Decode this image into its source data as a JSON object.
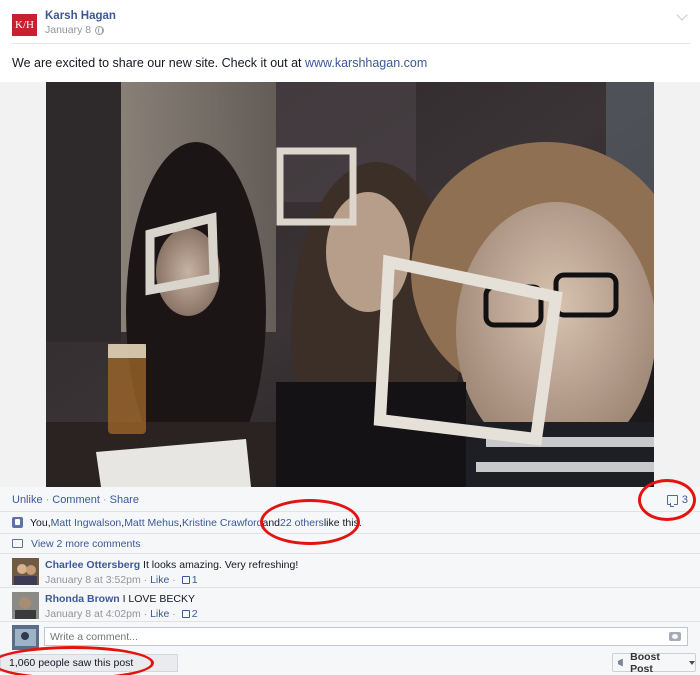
{
  "post": {
    "page_name": "Karsh Hagan",
    "logo_text": "K/H",
    "date": "January 8",
    "message_prefix": "We are excited to share our new site. Check it out at ",
    "message_link": "www.karshhagan.com"
  },
  "photo": {
    "icon": "photo-image"
  },
  "actions": {
    "unlike": "Unlike",
    "comment": "Comment",
    "share": "Share",
    "separator": "·",
    "comment_count": "3"
  },
  "likes": {
    "you": "You, ",
    "names": [
      "Matt Ingwalson",
      "Matt Mehus",
      "Kristine Crawford"
    ],
    "sep": ", ",
    "and": " and ",
    "others": "22 others",
    "suffix": " like this."
  },
  "view_more": "View 2 more comments",
  "comments": [
    {
      "name": "Charlee Ottersberg",
      "text": " It looks amazing. Very refreshing!",
      "time": "January 8 at 3:52pm",
      "like_label": "Like",
      "like_count": "1"
    },
    {
      "name": "Rhonda Brown",
      "text": " I LOVE BECKY",
      "time": "January 8 at 4:02pm",
      "like_label": "Like",
      "like_count": "2"
    }
  ],
  "write_comment": {
    "placeholder": "Write a comment..."
  },
  "reach": "1,060 people saw this post",
  "boost": "Boost Post",
  "colors": {
    "link": "#3b5998",
    "annotation": "#e3130f",
    "logo": "#c8202f"
  }
}
